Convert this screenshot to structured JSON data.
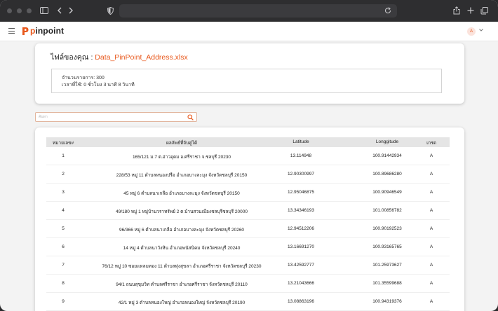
{
  "app": {
    "brand_prefix": "p",
    "brand_rest": "inpoint",
    "avatar_initial": "A"
  },
  "file_info": {
    "label": "ไฟล์ของคุณ : ",
    "filename": "Data_PinPoint_Address.xlsx",
    "record_count": "จำนวนรายการ: 300",
    "elapsed": "เวลาที่ใช้: 0 ชั่วโมง 3 นาที 8 วินาที"
  },
  "search": {
    "placeholder": "ค้นหา"
  },
  "table": {
    "headers": [
      "หมายเลข#",
      "ผลลัพธ์ที่จับคู่ได้",
      "Latitude",
      "Longgitude",
      "เกรด"
    ],
    "rows": [
      [
        "1",
        "165/121 ม.7 ต.อ่าวอุดม อ.ศรีราชา จ.ชลบุรี 20230",
        "13.114948",
        "100.91442934",
        "A"
      ],
      [
        "2",
        "228/53 หมู่ 11 ตำบลหนองปรือ อำเภอบางละมุง จังหวัดชลบุรี 20150",
        "12.90300997",
        "100.89686280",
        "A"
      ],
      [
        "3",
        "45 หมู่ 6 ตำบลนาเกลือ อำเภอบางละมุง จังหวัดชลบุรี 20150",
        "12.95046875",
        "100.90946549",
        "A"
      ],
      [
        "4",
        "49/180 หมู่ 1 หมู่บ้านวราทรัพย์ 2 ต.บ้านสวนเมืองชลบุรีชลบุรี 20000",
        "13.34346193",
        "101.00856782",
        "A"
      ],
      [
        "5",
        "96/366 หมู่ 6 ตำบลนาเกลือ อำเภอบางละมุง จังหวัดชลบุรี 20260",
        "12.94512206",
        "100.90192523",
        "A"
      ],
      [
        "6",
        "14 หมู่ 4 ตำบลนาวังหิน อำเภอพนัสนิคม จังหวัดชลบุรี 20240",
        "13.16691270",
        "100.93165765",
        "A"
      ],
      [
        "7",
        "76/12 หมู่ 10 ซอยแหลมทอง 11 ตำบลทุ่งสุขลา อำเภอศรีราชา จังหวัดชลบุรี 20230",
        "13.42592777",
        "101.25973627",
        "A"
      ],
      [
        "8",
        "94/1 ถนนสุขุมวิท ตำบลศรีราชา อำเภอศรีราชา จังหวัดชลบุรี 20110",
        "13.21043666",
        "101.35599688",
        "A"
      ],
      [
        "9",
        "42/1 หมู่ 3 ตำบลหนองใหญ่ อำเภอหนองใหญ่ จังหวัดชลบุรี 20190",
        "13.08863196",
        "100.94319376",
        "A"
      ]
    ]
  },
  "colors": {
    "accent": "#e8581c"
  }
}
